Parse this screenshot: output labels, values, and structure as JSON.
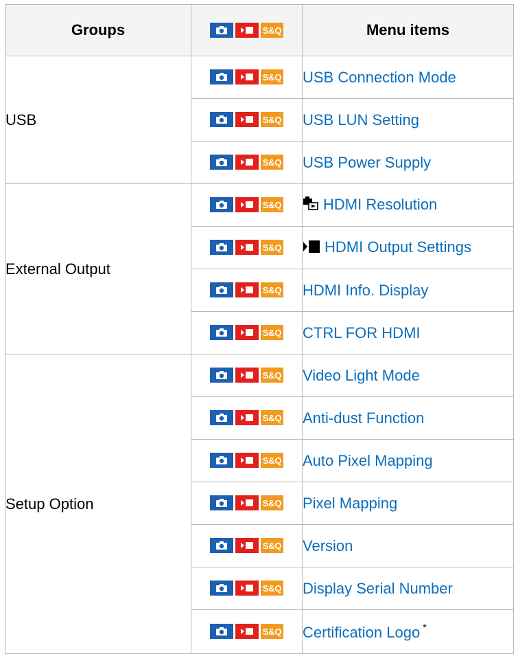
{
  "table": {
    "headers": {
      "groups": "Groups",
      "menu_items": "Menu items"
    },
    "mode_icons": {
      "photo": "camera-icon",
      "movie": "movie-icon",
      "sq": "S&Q",
      "colors": {
        "photo": "#1d5fb1",
        "movie": "#e2211c",
        "sq": "#f29a1f",
        "link": "#0a6ebd"
      }
    },
    "groups": [
      {
        "name": "USB",
        "items": [
          {
            "label": "USB Connection Mode"
          },
          {
            "label": "USB LUN Setting"
          },
          {
            "label": "USB Power Supply"
          }
        ]
      },
      {
        "name": "External Output",
        "items": [
          {
            "label": "HDMI Resolution",
            "prefix_icon": "still-playback-icon"
          },
          {
            "label": "HDMI Output Settings",
            "prefix_icon": "movie-mode-icon"
          },
          {
            "label": "HDMI Info. Display"
          },
          {
            "label": "CTRL FOR HDMI"
          }
        ]
      },
      {
        "name": "Setup Option",
        "items": [
          {
            "label": "Video Light Mode"
          },
          {
            "label": "Anti-dust Function"
          },
          {
            "label": "Auto Pixel Mapping"
          },
          {
            "label": "Pixel Mapping"
          },
          {
            "label": "Version"
          },
          {
            "label": "Display Serial Number"
          },
          {
            "label": "Certification Logo",
            "footnote": "*"
          }
        ]
      }
    ]
  }
}
